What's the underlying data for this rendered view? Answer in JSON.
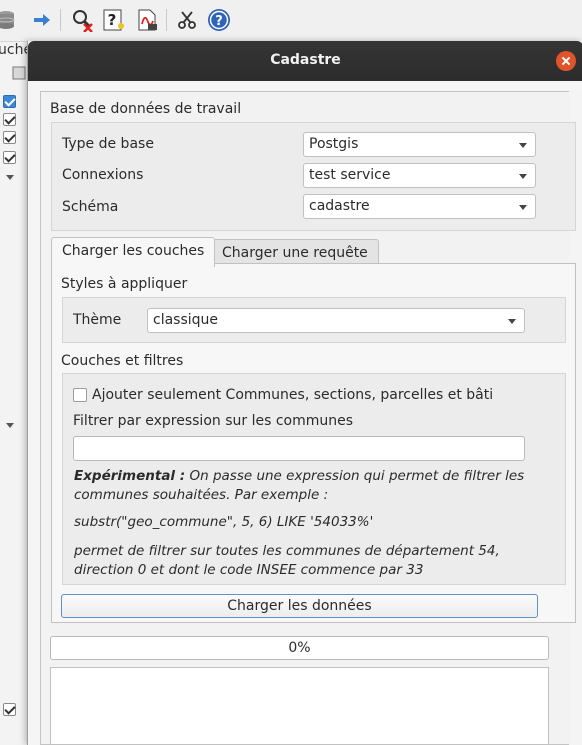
{
  "background": {
    "panel_title": "uche"
  },
  "dialog": {
    "title": "Cadastre",
    "db_group": {
      "title": "Base de données de travail",
      "type_label": "Type de base",
      "type_value": "Postgis",
      "conn_label": "Connexions",
      "conn_value": "test service",
      "schema_label": "Schéma",
      "schema_value": "cadastre"
    },
    "tabs": [
      {
        "label": "Charger les couches",
        "active": true
      },
      {
        "label": "Charger une requête",
        "active": false
      }
    ],
    "styles": {
      "title": "Styles à appliquer",
      "theme_label": "Thème",
      "theme_value": "classique"
    },
    "layers": {
      "title": "Couches et filtres",
      "checkbox_label": "Ajouter seulement Communes, sections, parcelles et bâti",
      "checkbox_checked": false,
      "filter_label": "Filtrer par expression sur les communes",
      "filter_value": "",
      "info_bold": "Expérimental :",
      "info_line1": "On passe une expression qui permet de filtrer les",
      "info_line2": "communes souhaitées. Par exemple :",
      "info_example": "substr(\"geo_commune\", 5, 6) LIKE '54033%'",
      "info_line3": "permet de filtrer sur toutes les communes de département 54,",
      "info_line4": "direction 0 et dont le code INSEE commence par 33"
    },
    "load_button": "Charger les données",
    "progress": {
      "text": "0%",
      "value": 0
    }
  }
}
